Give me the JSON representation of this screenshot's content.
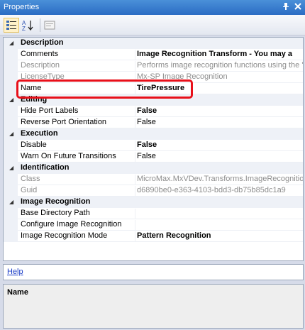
{
  "window": {
    "title": "Properties"
  },
  "toolbar": {
    "categorized_icon": "categorized-view-icon",
    "alphabetical_icon": "sort-alphabetical-icon",
    "property_pages_icon": "property-pages-icon"
  },
  "categories": {
    "description": "Description",
    "editing": "Editing",
    "execution": "Execution",
    "identification": "Identification",
    "image_recognition": "Image Recognition"
  },
  "properties": {
    "comments": {
      "name": "Comments",
      "value": "Image Recognition Transform - You may a"
    },
    "description": {
      "name": "Description",
      "value": "Performs image recognition functions using the 'NI"
    },
    "license_type": {
      "name": "LicenseType",
      "value": "Mx-SP Image Recognition"
    },
    "name": {
      "name": "Name",
      "value": "TirePressure"
    },
    "hide_port_labels": {
      "name": "Hide Port Labels",
      "value": "False"
    },
    "reverse_port_orientation": {
      "name": "Reverse Port Orientation",
      "value": "False"
    },
    "disable": {
      "name": "Disable",
      "value": "False"
    },
    "warn_on_future_transitions": {
      "name": "Warn On Future Transitions",
      "value": "False"
    },
    "class": {
      "name": "Class",
      "value": "MicroMax.MxVDev.Transforms.ImageRecognition."
    },
    "guid": {
      "name": "Guid",
      "value": "d6890be0-e363-4103-bdd3-db75b85dc1a9"
    },
    "base_directory_path": {
      "name": "Base Directory Path",
      "value": ""
    },
    "configure_image_recognition": {
      "name": "Configure Image Recognition",
      "value": ""
    },
    "image_recognition_mode": {
      "name": "Image Recognition Mode",
      "value": "Pattern Recognition"
    }
  },
  "commands": {
    "help": "Help"
  },
  "description_pane": {
    "name": "Name"
  },
  "colors": {
    "highlight": "#e8101a",
    "link": "#1a3cc7",
    "titlebar": "#2b6cc4"
  }
}
